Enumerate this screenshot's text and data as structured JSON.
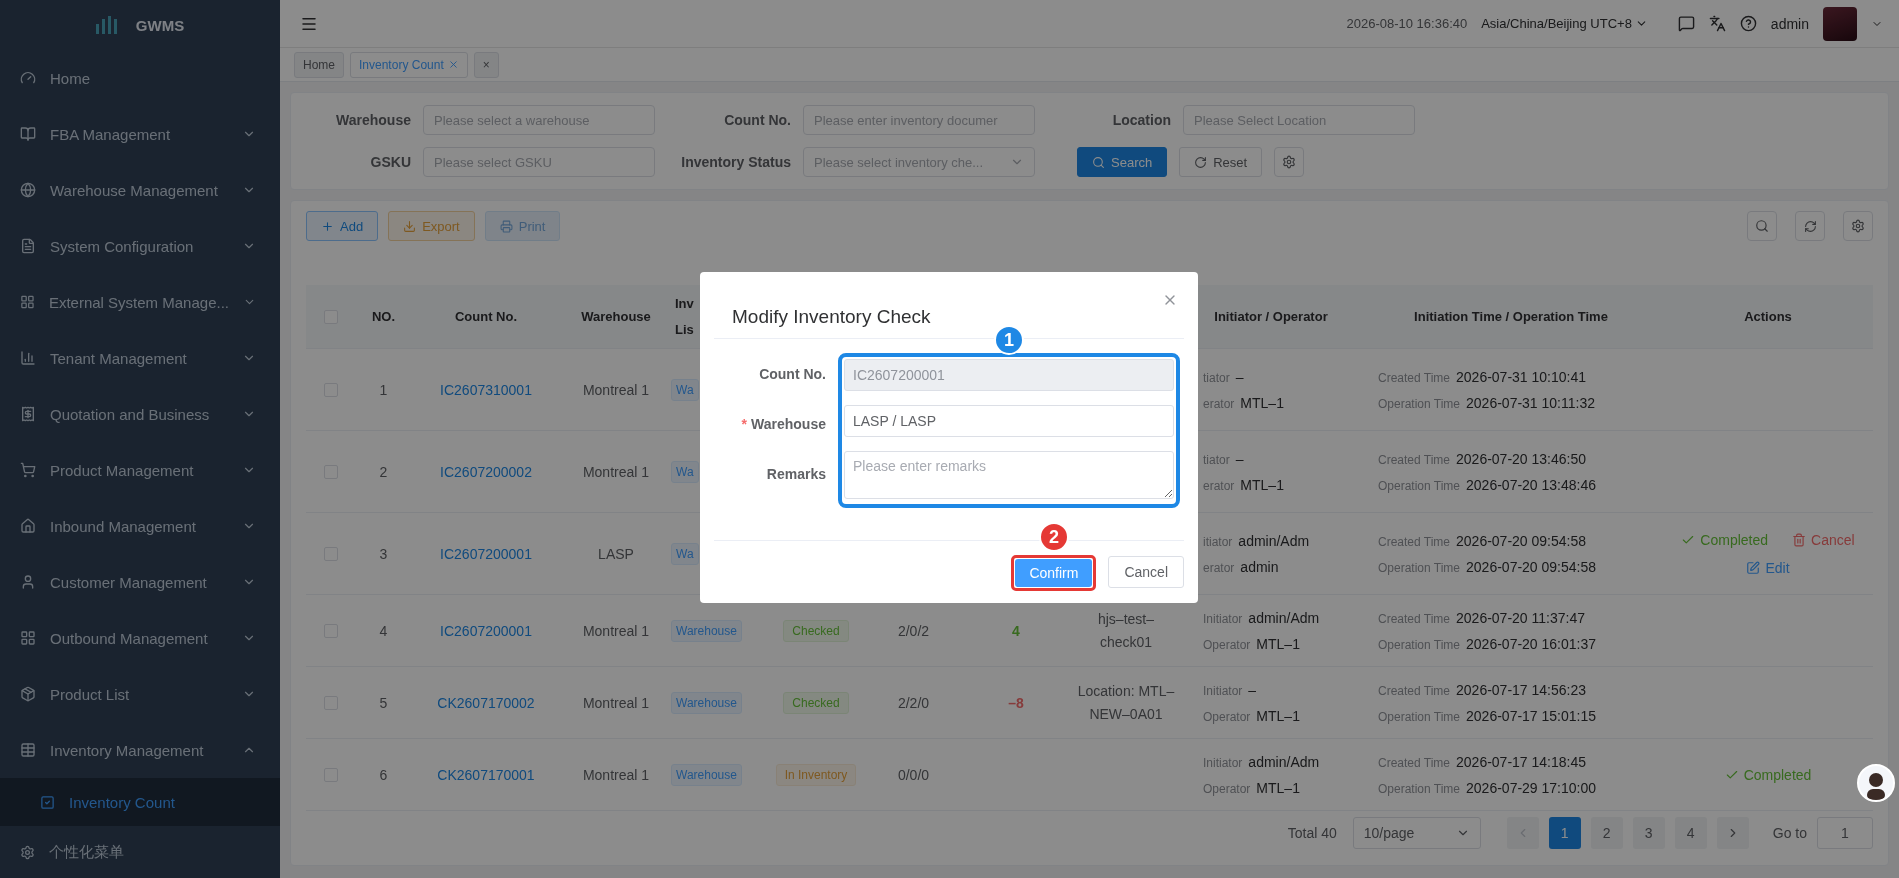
{
  "app": {
    "name": "GWMS"
  },
  "sidebar": {
    "items": [
      {
        "label": "Home",
        "kind": "link"
      },
      {
        "label": "FBA Management",
        "kind": "menu",
        "expanded": false
      },
      {
        "label": "Warehouse Management",
        "kind": "menu",
        "expanded": false
      },
      {
        "label": "System Configuration",
        "kind": "menu",
        "expanded": false
      },
      {
        "label": "External System Manage...",
        "kind": "menu",
        "expanded": false
      },
      {
        "label": "Tenant Management",
        "kind": "menu",
        "expanded": false
      },
      {
        "label": "Quotation and Business",
        "kind": "menu",
        "expanded": false
      },
      {
        "label": "Product Management",
        "kind": "menu",
        "expanded": false
      },
      {
        "label": "Inbound Management",
        "kind": "menu",
        "expanded": false
      },
      {
        "label": "Customer Management",
        "kind": "menu",
        "expanded": false
      },
      {
        "label": "Outbound Management",
        "kind": "menu",
        "expanded": false
      },
      {
        "label": "Product List",
        "kind": "menu",
        "expanded": false
      },
      {
        "label": "Inventory Management",
        "kind": "menu",
        "expanded": true,
        "children": [
          {
            "label": "Inventory Count",
            "selected": true
          }
        ]
      }
    ],
    "footer": "个性化菜单"
  },
  "header": {
    "datetime": "2026-08-10 16:36:40",
    "timezone": "Asia/China/Beijing UTC+8",
    "user": "admin"
  },
  "tabs": [
    {
      "label": "Home",
      "selected": false,
      "closable": false
    },
    {
      "label": "Inventory Count",
      "selected": true,
      "closable": true
    },
    {
      "label": "×",
      "selected": false,
      "closable": false
    }
  ],
  "filters": {
    "fields": [
      {
        "label": "Warehouse",
        "placeholder": "Please select a warehouse",
        "kind": "input"
      },
      {
        "label": "Count No.",
        "placeholder": "Please enter inventory documer",
        "kind": "input"
      },
      {
        "label": "Location",
        "placeholder": "Please Select Location",
        "kind": "input"
      },
      {
        "label": "GSKU",
        "placeholder": "Please select GSKU",
        "kind": "input"
      },
      {
        "label": "Inventory Status",
        "placeholder": "Please select inventory che...",
        "kind": "select"
      }
    ],
    "search": "Search",
    "reset": "Reset"
  },
  "toolbar": {
    "buttons": [
      {
        "label": "Add",
        "kind": "add",
        "disabled": false
      },
      {
        "label": "Export",
        "kind": "export",
        "disabled": false
      },
      {
        "label": "Print",
        "kind": "print",
        "disabled": true
      }
    ]
  },
  "table": {
    "all_checked": false,
    "columns": [
      "NO.",
      "Count No.",
      "Warehouse",
      "Inv Lis",
      "Initiator / Operator",
      "Initiation Time / Operation Time",
      "Actions"
    ],
    "rows": [
      {
        "checked": false,
        "no": "1",
        "count_no": "IC2607310001",
        "warehouse": "Montreal 1",
        "list_type": "Wa",
        "initiator": {
          "label": "tiator",
          "value": "–"
        },
        "operator": {
          "label": "erator",
          "value": "MTL–1"
        },
        "created": {
          "label": "Created Time",
          "value": "2026-07-31 10:10:41"
        },
        "operated": {
          "label": "Operation Time",
          "value": "2026-07-31 10:11:32"
        },
        "actions": []
      },
      {
        "checked": false,
        "no": "2",
        "count_no": "IC2607200002",
        "warehouse": "Montreal 1",
        "list_type": "Wa",
        "initiator": {
          "label": "tiator",
          "value": "–"
        },
        "operator": {
          "label": "erator",
          "value": "MTL–1"
        },
        "created": {
          "label": "Created Time",
          "value": "2026-07-20 13:46:50"
        },
        "operated": {
          "label": "Operation Time",
          "value": "2026-07-20 13:48:46"
        },
        "actions": []
      },
      {
        "checked": false,
        "no": "3",
        "count_no": "IC2607200001",
        "warehouse": "LASP",
        "list_type": "Wa",
        "initiator": {
          "label": "itiator",
          "value": "admin/Adm"
        },
        "operator": {
          "label": "erator",
          "value": "admin"
        },
        "created": {
          "label": "Created Time",
          "value": "2026-07-20 09:54:58"
        },
        "operated": {
          "label": "Operation Time",
          "value": "2026-07-20 09:54:58"
        },
        "actions": [
          {
            "kind": "complete",
            "label": "Completed"
          },
          {
            "kind": "cancel",
            "label": "Cancel"
          },
          {
            "kind": "edit",
            "label": "Edit"
          }
        ]
      },
      {
        "checked": false,
        "no": "4",
        "count_no": "IC2607200001",
        "warehouse": "Montreal 1",
        "list_type": "Warehouse",
        "status": {
          "label": "Checked",
          "kind": "done"
        },
        "counts": "2/0/2",
        "diff": {
          "value": "4",
          "kind": "positive"
        },
        "location": "hjs–test–check01",
        "initiator": {
          "label": "Initiator",
          "value": "admin/Adm"
        },
        "operator": {
          "label": "Operator",
          "value": "MTL–1"
        },
        "created": {
          "label": "Created Time",
          "value": "2026-07-20 11:37:47"
        },
        "operated": {
          "label": "Operation Time",
          "value": "2026-07-20 16:01:37"
        },
        "actions": []
      },
      {
        "checked": false,
        "no": "5",
        "count_no": "CK2607170002",
        "warehouse": "Montreal 1",
        "list_type": "Warehouse",
        "status": {
          "label": "Checked",
          "kind": "done"
        },
        "counts": "2/2/0",
        "diff": {
          "value": "–8",
          "kind": "negative"
        },
        "location": "Location: MTL–NEW–0A01",
        "initiator": {
          "label": "Initiator",
          "value": "–"
        },
        "operator": {
          "label": "Operator",
          "value": "MTL–1"
        },
        "created": {
          "label": "Created Time",
          "value": "2026-07-17 14:56:23"
        },
        "operated": {
          "label": "Operation Time",
          "value": "2026-07-17 15:01:15"
        },
        "actions": []
      },
      {
        "checked": false,
        "no": "6",
        "count_no": "CK2607170001",
        "warehouse": "Montreal 1",
        "list_type": "Warehouse",
        "status": {
          "label": "In Inventory",
          "kind": "progress"
        },
        "counts": "0/0/0",
        "initiator": {
          "label": "Initiator",
          "value": "admin/Adm"
        },
        "operator": {
          "label": "Operator",
          "value": "MTL–1"
        },
        "created": {
          "label": "Created Time",
          "value": "2026-07-17 14:18:45"
        },
        "operated": {
          "label": "Operation Time",
          "value": "2026-07-29 17:10:00"
        },
        "actions": [
          {
            "kind": "complete",
            "label": "Completed"
          }
        ]
      }
    ]
  },
  "pagination": {
    "total": "Total 40",
    "page_size": "10/page",
    "pages": [
      {
        "label": "1",
        "selected": true
      },
      {
        "label": "2",
        "selected": false
      },
      {
        "label": "3",
        "selected": false
      },
      {
        "label": "4",
        "selected": false
      }
    ],
    "goto_label": "Go to",
    "goto_value": "1"
  },
  "dialog": {
    "title": "Modify Inventory Check",
    "required_mark": "*",
    "fields": [
      {
        "label": "Count No.",
        "value": "IC2607200001",
        "required": false,
        "disabled": true,
        "kind": "input"
      },
      {
        "label": "Warehouse",
        "value": "LASP / LASP",
        "required": true,
        "disabled": false,
        "kind": "input"
      },
      {
        "label": "Remarks",
        "placeholder": "Please enter remarks",
        "required": false,
        "kind": "textarea"
      }
    ],
    "confirm": "Confirm",
    "cancel": "Cancel"
  },
  "annotations": [
    {
      "label": "1",
      "color": "#1e88e5"
    },
    {
      "label": "2",
      "color": "#e53935"
    }
  ]
}
